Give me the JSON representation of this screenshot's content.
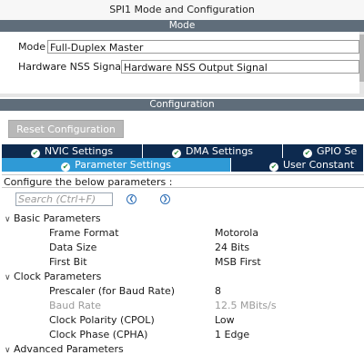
{
  "title": "SPI1 Mode and Configuration",
  "mode_section": {
    "header": "Mode",
    "mode_label": "Mode",
    "mode_value": "Full-Duplex Master",
    "nss_label": "Hardware NSS Signal",
    "nss_value": "Hardware NSS Output Signal"
  },
  "config_section": {
    "header": "Configuration",
    "reset_button": "Reset Configuration",
    "tabs_row1": [
      {
        "label": "NVIC Settings",
        "icon": "check-circle-icon"
      },
      {
        "label": "DMA Settings",
        "icon": "check-circle-icon"
      },
      {
        "label": "GPIO Se",
        "icon": "check-circle-icon"
      }
    ],
    "tabs_row2": [
      {
        "label": "Parameter Settings",
        "icon": "check-circle-icon",
        "active": true
      },
      {
        "label": "User Constant",
        "icon": "check-circle-icon"
      }
    ],
    "configure_text": "Configure the below parameters :",
    "search_placeholder": "Search (Ctrl+F)",
    "groups": [
      {
        "name": "Basic Parameters",
        "params": [
          {
            "name": "Frame Format",
            "value": "Motorola"
          },
          {
            "name": "Data Size",
            "value": "24 Bits"
          },
          {
            "name": "First Bit",
            "value": "MSB First"
          }
        ]
      },
      {
        "name": "Clock Parameters",
        "params": [
          {
            "name": "Prescaler (for Baud Rate)",
            "value": "8"
          },
          {
            "name": "Baud Rate",
            "value": "12.5 MBits/s",
            "disabled": true
          },
          {
            "name": "Clock Polarity (CPOL)",
            "value": "Low"
          },
          {
            "name": "Clock Phase (CPHA)",
            "value": "1 Edge"
          }
        ]
      },
      {
        "name": "Advanced Parameters",
        "params": []
      }
    ]
  },
  "colors": {
    "band": "#5f6d7a",
    "tab_dark": "#0d2a4f",
    "tab_active": "#2f9ad6",
    "check_green": "#2a8a3a"
  }
}
